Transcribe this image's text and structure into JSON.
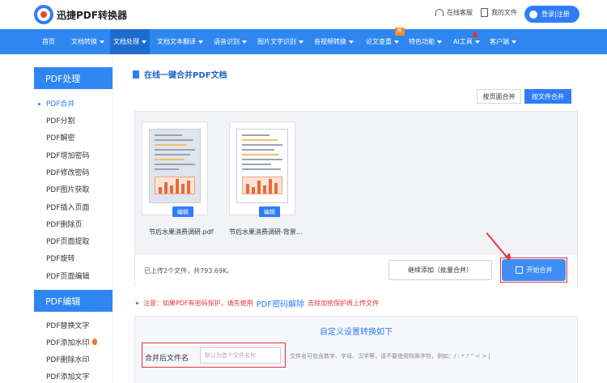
{
  "header": {
    "brand": "迅捷PDF转换器",
    "service": "在线客服",
    "my_files": "我的文件",
    "login": "登录|注册"
  },
  "nav": {
    "items": [
      {
        "label": "首页"
      },
      {
        "label": "文档转换"
      },
      {
        "label": "文档处理"
      },
      {
        "label": "文档文本翻译"
      },
      {
        "label": "语音识别"
      },
      {
        "label": "图片文字识别"
      },
      {
        "label": "音视频转换"
      },
      {
        "label": "论文查重"
      },
      {
        "label": "特色功能"
      },
      {
        "label": "AI工具"
      },
      {
        "label": "客户端"
      }
    ],
    "new_badge": "新"
  },
  "sidebar": {
    "section1_title": "PDF处理",
    "section1_items": [
      "PDF合并",
      "PDF分割",
      "PDF解密",
      "PDF增加密码",
      "PDF修改密码",
      "PDF图片获取",
      "PDF插入页面",
      "PDF删除页",
      "PDF页面提取",
      "PDF旋转",
      "PDF页面编辑"
    ],
    "section2_title": "PDF编辑",
    "section2_items": [
      "PDF替换文字",
      "PDF添加水印",
      "PDF删除水印",
      "PDF添加文字"
    ]
  },
  "main": {
    "title": "在线一键合并PDF文档",
    "mode_page": "按页面合并",
    "mode_file": "按文件合并",
    "files": [
      {
        "name": "节后水果消费调研.pdf",
        "edit": "编辑"
      },
      {
        "name": "节后水果消费调研-背景...",
        "edit": "编辑"
      }
    ],
    "upload_info": "已上传2个文件，共793.69K。",
    "continue_button": "继续添加（批量合并）",
    "merge_button": "开始合并",
    "notice_prefix": "注意：如果PDF有密码保护，请先使用",
    "notice_link": "PDF密码解除",
    "notice_suffix": "去除加密保护再上传文件"
  },
  "settings": {
    "title": "自定义设置转换如下",
    "filename_label": "合并后文件名",
    "filename_placeholder": "默认为首个文件名称",
    "filename_hint": "文件名可包含数字、字母、汉字等，请不要使用特殊字符，例如：/ : * ? \" < > |"
  },
  "colors": {
    "primary": "#2f86f0",
    "accent_blue": "#2f7df6",
    "annotation_red": "#e5333a"
  }
}
